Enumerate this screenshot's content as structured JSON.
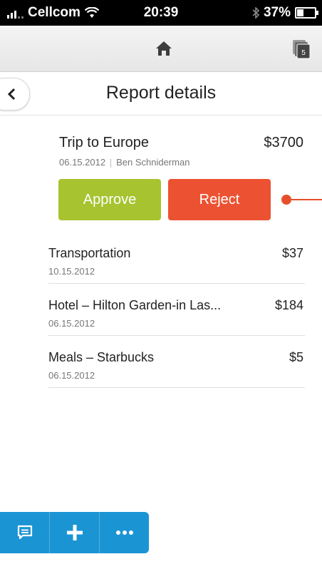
{
  "status_bar": {
    "carrier": "Cellcom",
    "time": "20:39",
    "battery": "37%"
  },
  "title_bar": {
    "title": "Report details"
  },
  "report": {
    "title": "Trip to Europe",
    "amount": "$3700",
    "date": "06.15.2012",
    "submitter": "Ben Schniderman",
    "approve_label": "Approve",
    "reject_label": "Reject"
  },
  "items": [
    {
      "name": "Transportation",
      "date": "10.15.2012",
      "amount": "$37"
    },
    {
      "name": "Hotel – Hilton Garden-in Las...",
      "date": "06.15.2012",
      "amount": "$184"
    },
    {
      "name": "Meals – Starbucks",
      "date": "06.15.2012",
      "amount": "$5"
    }
  ],
  "toolbar": {
    "icons": [
      "comment-icon",
      "plus-icon",
      "more-icon"
    ]
  },
  "colors": {
    "approve": "#a7c330",
    "reject": "#ec5231",
    "toolbar": "#1b94d4"
  }
}
